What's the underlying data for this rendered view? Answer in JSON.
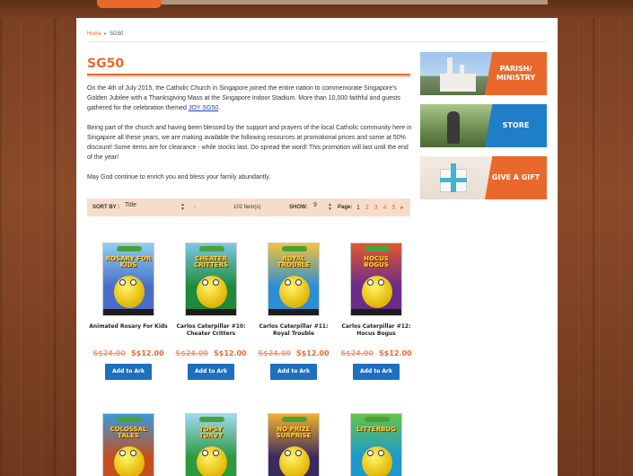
{
  "breadcrumb": {
    "home": "Home",
    "separator": "▸",
    "current": "SG50"
  },
  "page_title": "SG50",
  "intro": {
    "p1_before_link": "On the 4th of July 2015, the Catholic Church in Singapore joined the entire nation to commemorate Singapore's Golden Jubilee with a Thanksgiving Mass at the Singapore Indoor Stadium. More than 10,000 faithful and guests gathered for the celebration themed ",
    "p1_link": "JOY SG50",
    "p1_after_link": ".",
    "p2": "Being part of the church and having been blessed by the support and prayers of the local Catholic community here in Singapore all these years, we are making available the following resources at promotional prices and some at 50% discount! Some items are for clearance - while stocks last. Do spread the word! This promotion will last until the end of the year!",
    "p3": "May God continue to enrich you and bless your family abundantly."
  },
  "toolbar": {
    "sort_label": "SORT BY :",
    "sort_value": "Title",
    "item_count": "102 Item(s)",
    "show_label": "SHOW:",
    "show_value": "9",
    "page_label": "Page:",
    "pages": [
      "1",
      "2",
      "3",
      "4",
      "5"
    ],
    "current_page": "1",
    "next_arrow": "▸"
  },
  "products": [
    {
      "name": "Animated Rosary For Kids",
      "old_price": "S$24.00",
      "price": "S$12.00",
      "button": "Add to Ark",
      "cover_title": "ROSARY FOR KIDS",
      "cover_color": "#4a6ec8",
      "accent": "#8fd0f0"
    },
    {
      "name": "Carlos Caterpillar #10: Cheater Critters",
      "old_price": "S$24.00",
      "price": "S$12.00",
      "button": "Add to Ark",
      "cover_title": "CHEATER CRITTERS",
      "cover_color": "#1f8a3a",
      "accent": "#7cc7e8"
    },
    {
      "name": "Carlos Caterpillar #11: Royal Trouble",
      "old_price": "S$24.00",
      "price": "S$12.00",
      "button": "Add to Ark",
      "cover_title": "ROYAL TROUBLE",
      "cover_color": "#2b8fd6",
      "accent": "#f2c23a"
    },
    {
      "name": "Carlos Caterpillar #12: Hocus Bogus",
      "old_price": "S$24.00",
      "price": "S$12.00",
      "button": "Add to Ark",
      "cover_title": "HOCUS BOGUS",
      "cover_color": "#6a2d8c",
      "accent": "#e4572e"
    },
    {
      "name": "",
      "old_price": "",
      "price": "",
      "button": "",
      "cover_title": "COLOSSAL TALES",
      "cover_color": "#c44e1e",
      "accent": "#3a9ad9"
    },
    {
      "name": "",
      "old_price": "",
      "price": "",
      "button": "",
      "cover_title": "TOPSY TURVY",
      "cover_color": "#2d9a3e",
      "accent": "#9fd9f2"
    },
    {
      "name": "",
      "old_price": "",
      "price": "",
      "button": "",
      "cover_title": "NO PRIZE SURPRISE",
      "cover_color": "#3b2a5e",
      "accent": "#f0b02f"
    },
    {
      "name": "",
      "old_price": "",
      "price": "",
      "button": "",
      "cover_title": "LITTERBUG",
      "cover_color": "#1b9ad0",
      "accent": "#66c24a"
    }
  ],
  "sidebar": {
    "banners": [
      {
        "label_line1": "PARISH/",
        "label_line2": "MINISTRY"
      },
      {
        "label_line1": "STORE",
        "label_line2": ""
      },
      {
        "label_line1": "GIVE A GIFT",
        "label_line2": ""
      }
    ]
  },
  "colors": {
    "accent": "#e9692c",
    "button": "#1e6fc0",
    "link": "#1f3fb8",
    "toolbar_bg": "#f8dccb"
  }
}
